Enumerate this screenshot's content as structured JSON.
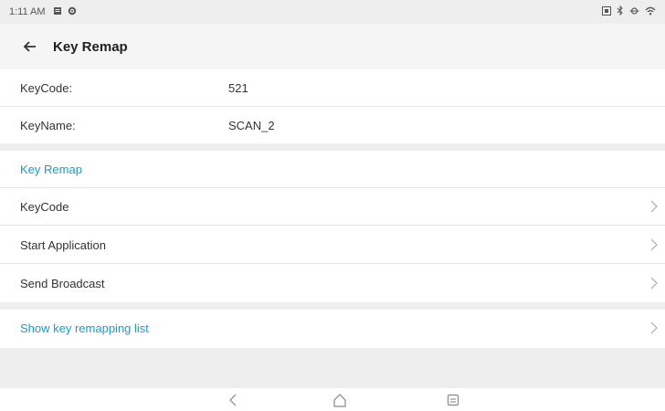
{
  "status_bar": {
    "time": "1:11 AM",
    "left_icons": [
      "notification-icon",
      "settings-icon"
    ],
    "right_icons": [
      "nfc-icon",
      "bluetooth-icon",
      "vibrate-icon",
      "wifi-icon"
    ]
  },
  "app_bar": {
    "title": "Key Remap",
    "back_icon": "arrow-back-icon"
  },
  "info": [
    {
      "label": "KeyCode:",
      "value": "521"
    },
    {
      "label": "KeyName:",
      "value": "SCAN_2"
    }
  ],
  "section": {
    "header": "Key Remap"
  },
  "items": [
    {
      "label": "KeyCode"
    },
    {
      "label": "Start Application"
    },
    {
      "label": "Send Broadcast"
    }
  ],
  "list_link": {
    "label": "Show key remapping list"
  },
  "nav": {
    "back": "back-icon",
    "home": "home-icon",
    "recents": "recents-icon"
  },
  "colors": {
    "accent": "#1e9ac4",
    "divider": "#eeeeee"
  }
}
